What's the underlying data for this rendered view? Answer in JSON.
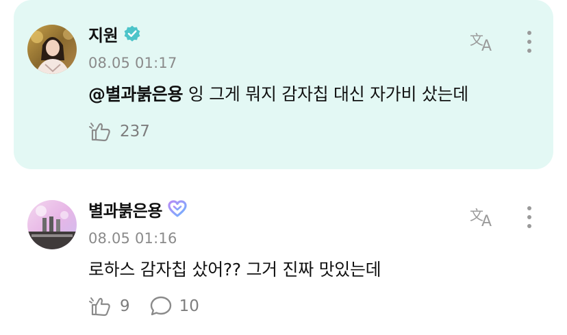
{
  "comments": [
    {
      "author": "지원",
      "verified_badge": "verified-check-icon",
      "timestamp": "08.05 01:17",
      "mention": "@별과붉은용",
      "text": " 잉 그게 뭐지 감자칩 대신 자가비 샀는데",
      "like_count": "237",
      "highlighted": true
    },
    {
      "author": "별과붉은용",
      "member_badge": "heart-badge-icon",
      "timestamp": "08.05 01:16",
      "text": "로하스 감자칩 샀어?? 그거 진짜 맛있는데",
      "like_count": "9",
      "reply_count": "10"
    }
  ],
  "icons": {
    "translate": "translate-icon",
    "more": "more-vertical-icon",
    "like": "like-icon",
    "reply": "reply-bubble-icon"
  },
  "colors": {
    "highlight_bg": "#e3f8f4",
    "verified": "#4cc4c9",
    "heart_badge_start": "#b68cf5",
    "heart_badge_end": "#6fb1ff",
    "muted": "#8a8a8a"
  }
}
